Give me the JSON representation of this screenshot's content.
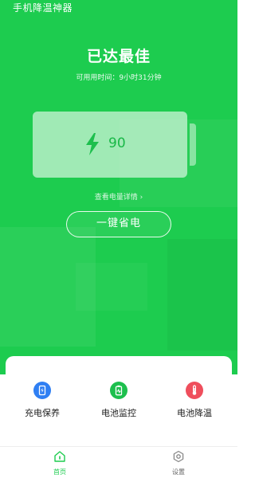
{
  "app": {
    "title": "手机降温神器"
  },
  "status": {
    "title": "已达最佳",
    "available_time": "可用用时间：9小时31分钟"
  },
  "battery": {
    "level": "90",
    "details_link": "查看电量详情 ›"
  },
  "actions": {
    "one_key_save": "一键省电"
  },
  "tools": [
    {
      "label": "充电保养",
      "icon": "charge-protect-icon",
      "color": "#2f7ff3"
    },
    {
      "label": "电池监控",
      "icon": "battery-monitor-icon",
      "color": "#1dbf4d"
    },
    {
      "label": "电池降温",
      "icon": "thermometer-icon",
      "color": "#ef4e5c"
    }
  ],
  "nav": {
    "home": "首页",
    "settings": "设置"
  },
  "colors": {
    "accent": "#1dcc4f"
  }
}
